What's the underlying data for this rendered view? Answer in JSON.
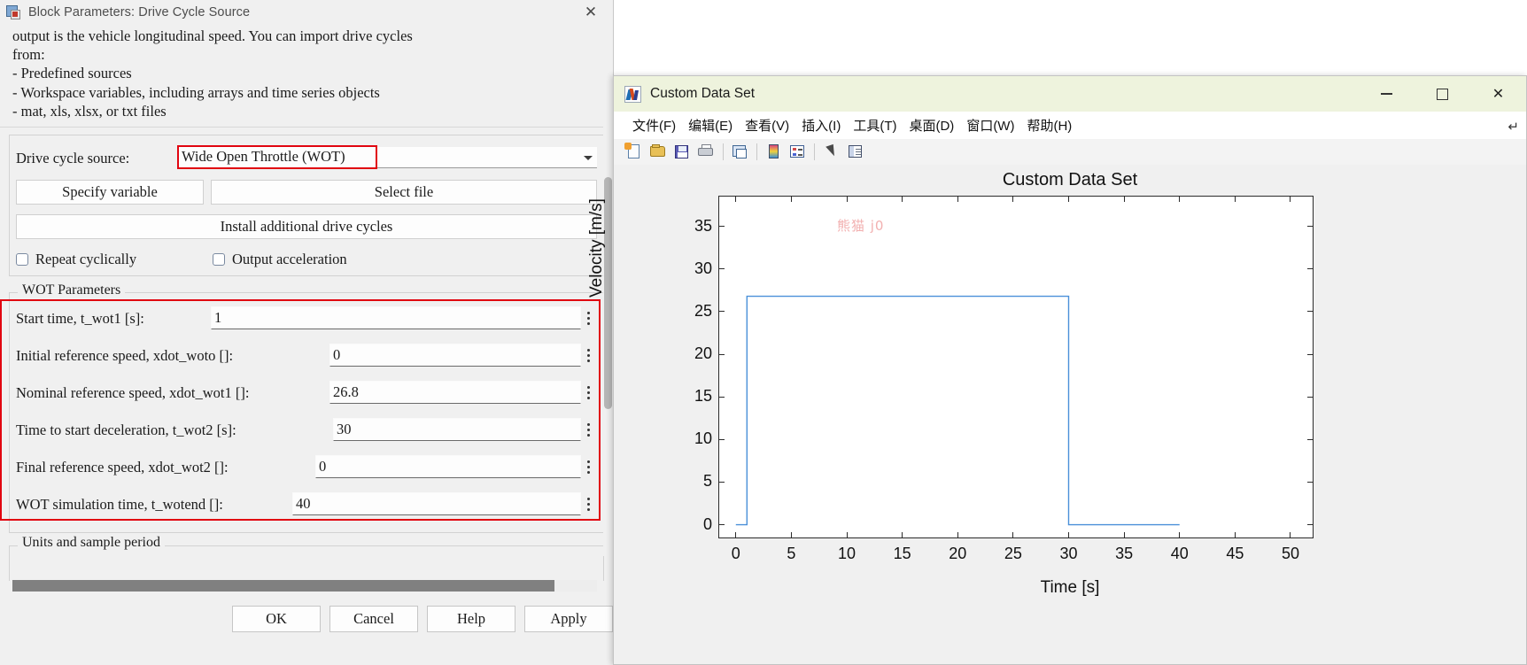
{
  "block_dialog": {
    "title": "Block Parameters: Drive Cycle Source",
    "close_label": "✕",
    "description": "output is the vehicle longitudinal speed. You can import drive cycles\nfrom:\n- Predefined sources\n- Workspace variables, including arrays and time series objects\n- mat, xls, xlsx, or txt files",
    "source_label": "Drive cycle source:",
    "source_value": "Wide Open Throttle (WOT)",
    "specify_variable_label": "Specify variable",
    "select_file_label": "Select file",
    "install_label": "Install additional drive cycles",
    "repeat_cyclically_label": "Repeat cyclically",
    "output_acceleration_label": "Output acceleration",
    "wot_group_label": "WOT Parameters",
    "units_group_label": "Units and sample period",
    "parameters": [
      {
        "label": "Start time, t_wot1 [s]:",
        "value": "1"
      },
      {
        "label": "Initial reference speed, xdot_woto []:",
        "value": "0"
      },
      {
        "label": "Nominal reference speed, xdot_wot1 []:",
        "value": "26.8"
      },
      {
        "label": "Time to start deceleration, t_wot2 [s]:",
        "value": "30"
      },
      {
        "label": "Final reference speed, xdot_wot2 []:",
        "value": "0"
      },
      {
        "label": "WOT simulation time, t_wotend []:",
        "value": "40"
      }
    ],
    "buttons": {
      "ok": "OK",
      "cancel": "Cancel",
      "help": "Help",
      "apply": "Apply"
    },
    "highlight_color": "#e10510"
  },
  "figure_window": {
    "title": "Custom Data Set",
    "window_buttons": {
      "minimize": "—",
      "maximize": "☐",
      "close": "✕"
    },
    "menu_corner": "↵",
    "menus": [
      "文件(F)",
      "编辑(E)",
      "查看(V)",
      "插入(I)",
      "工具(T)",
      "桌面(D)",
      "窗口(W)",
      "帮助(H)"
    ],
    "toolbar": [
      "new-figure-icon",
      "open-file-icon",
      "save-figure-icon",
      "print-figure-icon",
      "sep",
      "link-plot-icon",
      "sep",
      "colorbar-icon",
      "legend-icon",
      "sep",
      "pointer-icon",
      "property-inspector-icon"
    ],
    "watermark": "熊猫 j0"
  },
  "chart_data": {
    "type": "line",
    "title": "Custom Data Set",
    "xlabel": "Time [s]",
    "ylabel": "Velocity [m/s]",
    "xlim": [
      -1.5,
      52
    ],
    "ylim": [
      -1.5,
      38.5
    ],
    "xticks": [
      0,
      5,
      10,
      15,
      20,
      25,
      30,
      35,
      40,
      45,
      50
    ],
    "yticks": [
      0,
      5,
      10,
      15,
      20,
      25,
      30,
      35
    ],
    "grid": false,
    "legend": null,
    "series": [
      {
        "name": "Velocity",
        "color": "#4a90d9",
        "x": [
          0,
          1,
          1,
          30,
          30,
          40
        ],
        "y": [
          0,
          0,
          26.8,
          26.8,
          0,
          0
        ]
      }
    ]
  }
}
